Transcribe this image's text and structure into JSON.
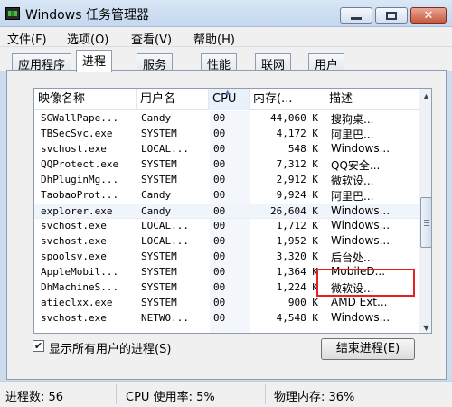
{
  "window": {
    "title": "Windows 任务管理器",
    "close_glyph": "✕"
  },
  "menu": {
    "items": [
      "文件(F)",
      "选项(O)",
      "查看(V)",
      "帮助(H)"
    ]
  },
  "tabs": [
    "应用程序",
    "进程",
    "服务",
    "性能",
    "联网",
    "用户"
  ],
  "active_tab": "进程",
  "table": {
    "columns": [
      "映像名称",
      "用户名",
      "CPU",
      "内存(...",
      "描述"
    ],
    "sort_column": "CPU",
    "rows": [
      {
        "name": "SGWallPape...",
        "user": "Candy",
        "cpu": "00",
        "mem": "44,060 K",
        "desc": "搜狗桌..."
      },
      {
        "name": "TBSecSvc.exe",
        "user": "SYSTEM",
        "cpu": "00",
        "mem": "4,172 K",
        "desc": "阿里巴..."
      },
      {
        "name": "svchost.exe",
        "user": "LOCAL...",
        "cpu": "00",
        "mem": "548 K",
        "desc": "Windows..."
      },
      {
        "name": "QQProtect.exe",
        "user": "SYSTEM",
        "cpu": "00",
        "mem": "7,312 K",
        "desc": "QQ安全..."
      },
      {
        "name": "DhPluginMg...",
        "user": "SYSTEM",
        "cpu": "00",
        "mem": "2,912 K",
        "desc": "微软设..."
      },
      {
        "name": "TaobaoProt...",
        "user": "Candy",
        "cpu": "00",
        "mem": "9,924 K",
        "desc": "阿里巴..."
      },
      {
        "name": "explorer.exe",
        "user": "Candy",
        "cpu": "00",
        "mem": "26,604 K",
        "desc": "Windows..."
      },
      {
        "name": "svchost.exe",
        "user": "LOCAL...",
        "cpu": "00",
        "mem": "1,712 K",
        "desc": "Windows..."
      },
      {
        "name": "svchost.exe",
        "user": "LOCAL...",
        "cpu": "00",
        "mem": "1,952 K",
        "desc": "Windows..."
      },
      {
        "name": "spoolsv.exe",
        "user": "SYSTEM",
        "cpu": "00",
        "mem": "3,320 K",
        "desc": "后台处..."
      },
      {
        "name": "AppleMobil...",
        "user": "SYSTEM",
        "cpu": "00",
        "mem": "1,364 K",
        "desc": "MobileD..."
      },
      {
        "name": "DhMachineS...",
        "user": "SYSTEM",
        "cpu": "00",
        "mem": "1,224 K",
        "desc": "微软设..."
      },
      {
        "name": "atieclxx.exe",
        "user": "SYSTEM",
        "cpu": "00",
        "mem": "900 K",
        "desc": "AMD Ext..."
      },
      {
        "name": "svchost.exe",
        "user": "NETWO...",
        "cpu": "00",
        "mem": "4,548 K",
        "desc": "Windows..."
      }
    ],
    "selected_row": 6
  },
  "scroll": {
    "up_glyph": "▲",
    "down_glyph": "▼"
  },
  "show_all_users": {
    "checked": true,
    "check_glyph": "✔",
    "label": "显示所有用户的进程(S)"
  },
  "end_process_button": "结束进程(E)",
  "status": {
    "processes": "进程数: 56",
    "cpu": "CPU 使用率: 5%",
    "memory": "物理内存: 36%"
  },
  "colors": {
    "highlight_box": "#e82020",
    "title_bar": "#d9e7f6"
  }
}
